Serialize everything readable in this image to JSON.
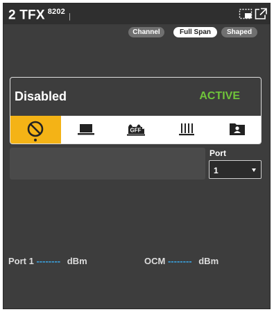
{
  "header": {
    "title": "2 TFX",
    "device_id": "8202",
    "separator": "|"
  },
  "filter_pills": [
    {
      "label": "Channel",
      "selected": false
    },
    {
      "label": "Full Span",
      "selected": true
    },
    {
      "label": "Shaped",
      "selected": false
    }
  ],
  "status": {
    "label": "Disabled",
    "value": "ACTIVE",
    "value_color": "#6fc43a"
  },
  "modes": [
    {
      "icon": "disabled-icon",
      "active": true
    },
    {
      "icon": "laptop-icon",
      "active": false
    },
    {
      "icon": "gff-icon",
      "active": false
    },
    {
      "icon": "comb-icon",
      "active": false
    },
    {
      "icon": "folder-user-icon",
      "active": false
    }
  ],
  "port": {
    "label": "Port",
    "selected": "1"
  },
  "readings": {
    "port1": {
      "label": "Port 1",
      "value": "--------",
      "unit": "dBm"
    },
    "ocm": {
      "label": "OCM",
      "value": "--------",
      "unit": "dBm"
    }
  },
  "colors": {
    "panel_bg": "#3d3d3d",
    "accent": "#f4b316",
    "active_status": "#6fc43a",
    "dash": "#3aa8e8"
  }
}
